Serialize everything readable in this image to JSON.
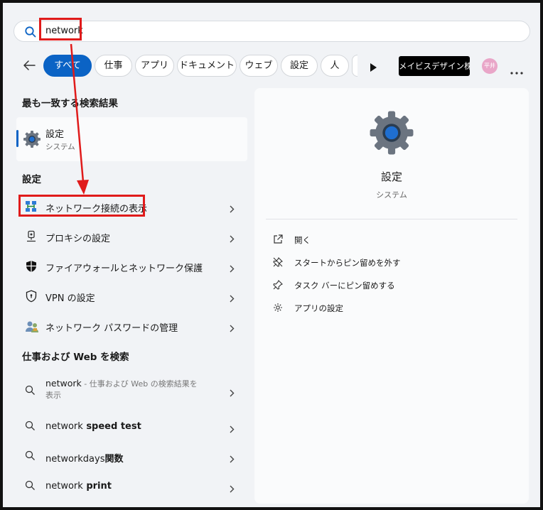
{
  "search": {
    "query": "network"
  },
  "filters": {
    "chips": [
      {
        "label": "すべて",
        "active": true
      },
      {
        "label": "仕事"
      },
      {
        "label": "アプリ"
      },
      {
        "label": "ドキュメント"
      },
      {
        "label": "ウェブ"
      },
      {
        "label": "設定"
      },
      {
        "label": "人"
      }
    ],
    "company_label": "メイビスデザイン株...",
    "avatar_text": "平井"
  },
  "best_match": {
    "heading": "最も一致する検索結果",
    "title": "設定",
    "subtitle": "システム"
  },
  "settings_section": {
    "heading": "設定",
    "items": [
      {
        "label": "ネットワーク接続の表示",
        "icon": "network-connections-icon"
      },
      {
        "label": "プロキシの設定",
        "icon": "proxy-icon"
      },
      {
        "label": "ファイアウォールとネットワーク保護",
        "icon": "shield-filled-icon"
      },
      {
        "label": "VPN の設定",
        "icon": "shield-outline-icon"
      },
      {
        "label": "ネットワーク パスワードの管理",
        "icon": "users-key-icon"
      }
    ]
  },
  "web_section": {
    "heading": "仕事および Web を検索",
    "items": [
      {
        "prefix": "network",
        "bold": "",
        "suffix": " - 仕事および Web の検索結果を",
        "suffix2": "表示"
      },
      {
        "prefix": "network",
        "bold": " speed test"
      },
      {
        "prefix": "networkdays",
        "bold": "関数"
      },
      {
        "prefix": "network",
        "bold": " print"
      }
    ]
  },
  "detail_panel": {
    "title": "設定",
    "subtitle": "システム",
    "actions": [
      {
        "label": "開く",
        "icon": "open-external-icon"
      },
      {
        "label": "スタートからピン留めを外す",
        "icon": "unpin-icon"
      },
      {
        "label": "タスク バーにピン留めする",
        "icon": "pin-icon"
      },
      {
        "label": "アプリの設定",
        "icon": "gear-small-icon"
      }
    ]
  },
  "colors": {
    "accent": "#0b63c5",
    "annotation_red": "#e01b1b",
    "background": "#f1f3f6"
  }
}
